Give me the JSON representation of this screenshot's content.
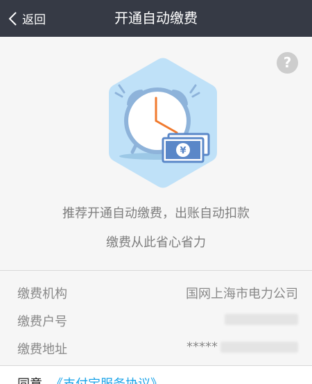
{
  "nav": {
    "back_label": "返回",
    "title": "开通自动缴费"
  },
  "hero": {
    "help_label": "?",
    "tagline_line1": "推荐开通自动缴费，出账自动扣款",
    "tagline_line2": "缴费从此省心省力",
    "bill_symbol": "¥"
  },
  "info": {
    "rows": [
      {
        "label": "缴费机构",
        "value": "国网上海市电力公司"
      },
      {
        "label": "缴费户号",
        "value": ""
      },
      {
        "label": "缴费地址",
        "value": "*****"
      }
    ]
  },
  "agreement": {
    "prefix": "同意",
    "link": "《支付宝服务协议》"
  },
  "colors": {
    "nav_bg": "#363a45",
    "link": "#1aa3e8",
    "illustration_bg": "#bfe1f8",
    "clock_hand": "#f07a2e",
    "bill": "#5a87c8"
  }
}
